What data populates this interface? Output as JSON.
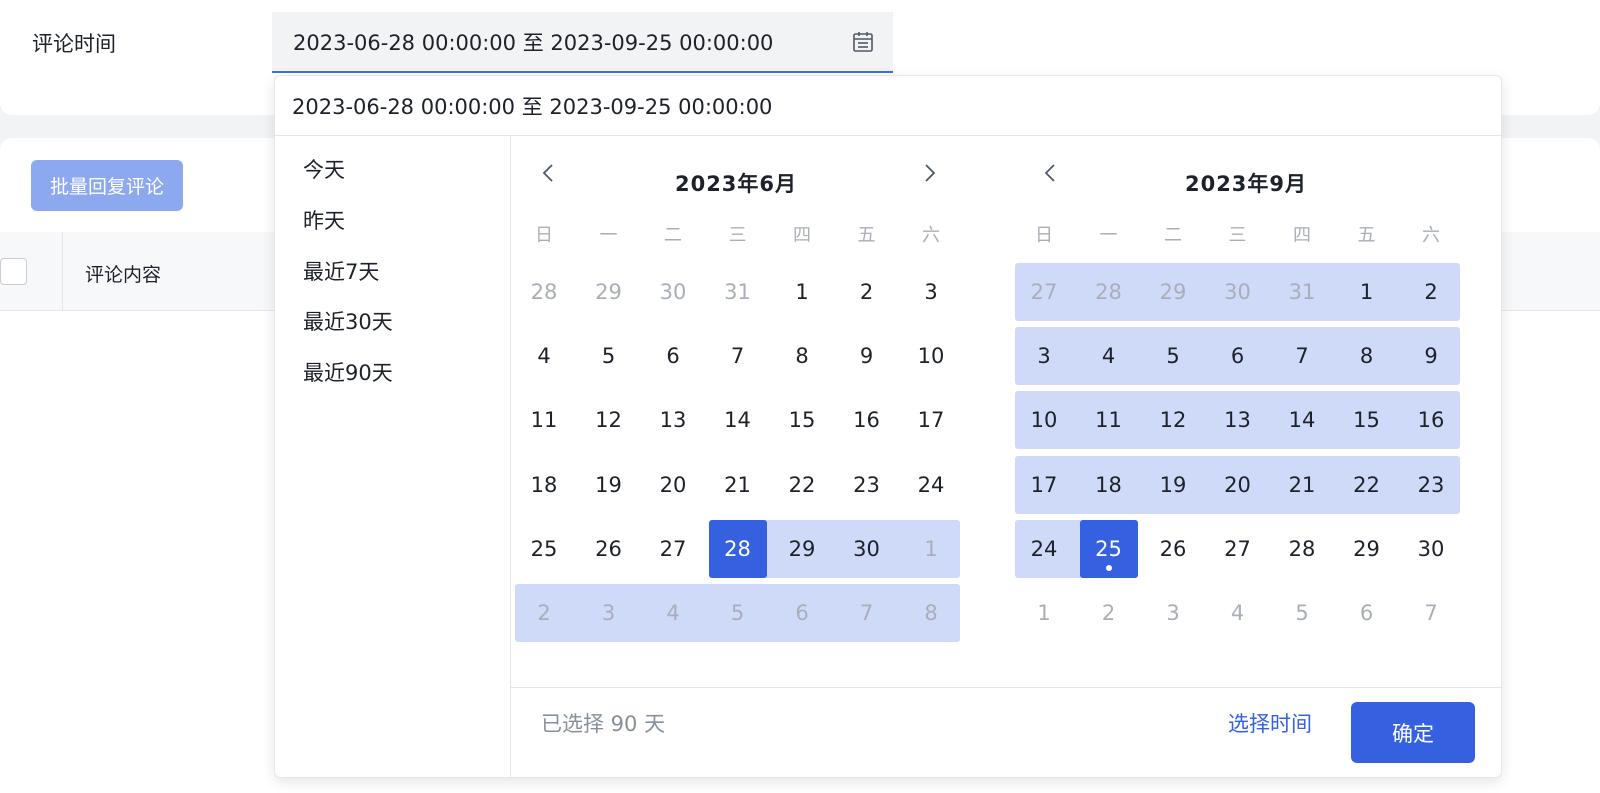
{
  "filter": {
    "label": "评论时间",
    "range_value": "2023-06-28 00:00:00 至 2023-09-25 00:00:00"
  },
  "toolbar": {
    "batch_reply_label": "批量回复评论"
  },
  "table": {
    "columns": [
      "评论内容"
    ]
  },
  "picker": {
    "header_value": "2023-06-28 00:00:00 至 2023-09-25 00:00:00",
    "shortcuts": [
      "今天",
      "昨天",
      "最近7天",
      "最近30天",
      "最近90天"
    ],
    "weekdays": [
      "日",
      "一",
      "二",
      "三",
      "四",
      "五",
      "六"
    ],
    "calendars": [
      {
        "title": "2023年6月",
        "weeks": [
          [
            "28",
            "29",
            "30",
            "31",
            "1",
            "2",
            "3"
          ],
          [
            "4",
            "5",
            "6",
            "7",
            "8",
            "9",
            "10"
          ],
          [
            "11",
            "12",
            "13",
            "14",
            "15",
            "16",
            "17"
          ],
          [
            "18",
            "19",
            "20",
            "21",
            "22",
            "23",
            "24"
          ],
          [
            "25",
            "26",
            "27",
            "28",
            "29",
            "30",
            "1"
          ],
          [
            "2",
            "3",
            "4",
            "5",
            "6",
            "7",
            "8"
          ]
        ],
        "first_in_month_index": 4,
        "last_in_month_index": 33,
        "selected_start_index": 31,
        "selected_end_index": null,
        "today_index": null,
        "range_from_index": 31,
        "range_to_index": 41
      },
      {
        "title": "2023年9月",
        "weeks": [
          [
            "27",
            "28",
            "29",
            "30",
            "31",
            "1",
            "2"
          ],
          [
            "3",
            "4",
            "5",
            "6",
            "7",
            "8",
            "9"
          ],
          [
            "10",
            "11",
            "12",
            "13",
            "14",
            "15",
            "16"
          ],
          [
            "17",
            "18",
            "19",
            "20",
            "21",
            "22",
            "23"
          ],
          [
            "24",
            "25",
            "26",
            "27",
            "28",
            "29",
            "30"
          ],
          [
            "1",
            "2",
            "3",
            "4",
            "5",
            "6",
            "7"
          ]
        ],
        "first_in_month_index": 5,
        "last_in_month_index": 34,
        "selected_start_index": null,
        "selected_end_index": 29,
        "today_index": 29,
        "range_from_index": 0,
        "range_to_index": 29
      }
    ],
    "selected_summary": "已选择 90 天",
    "choose_time_label": "选择时间",
    "confirm_label": "确定"
  },
  "colors": {
    "accent": "#3561e0",
    "range_fill": "#cfdaf8",
    "muted_text": "#a9aeb8"
  }
}
